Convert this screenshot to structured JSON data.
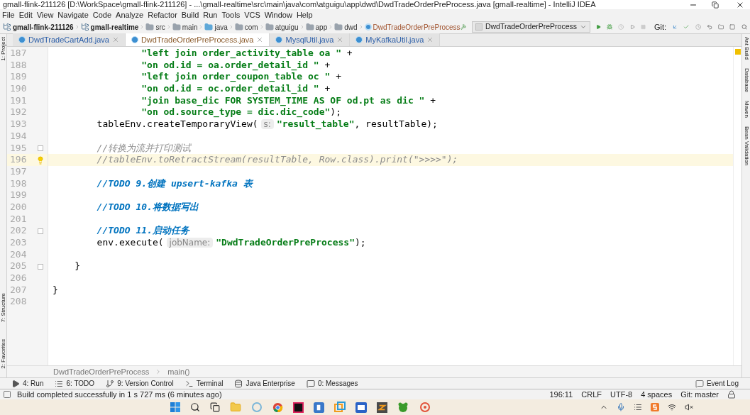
{
  "window": {
    "title": "gmall-flink-211126 [D:\\WorkSpace\\gmall-flink-211126] - ...\\gmall-realtime\\src\\main\\java\\com\\atguigu\\app\\dwd\\DwdTradeOrderPreProcess.java [gmall-realtime] - IntelliJ IDEA"
  },
  "menu": [
    "File",
    "Edit",
    "View",
    "Navigate",
    "Code",
    "Analyze",
    "Refactor",
    "Build",
    "Run",
    "Tools",
    "VCS",
    "Window",
    "Help"
  ],
  "navbar": {
    "crumbs": [
      {
        "kind": "module",
        "label": "gmall-flink-211126"
      },
      {
        "kind": "module",
        "label": "gmall-realtime"
      },
      {
        "kind": "folder",
        "label": "src"
      },
      {
        "kind": "folder",
        "label": "main"
      },
      {
        "kind": "source",
        "label": "java"
      },
      {
        "kind": "folder",
        "label": "com"
      },
      {
        "kind": "folder",
        "label": "atguigu"
      },
      {
        "kind": "folder",
        "label": "app"
      },
      {
        "kind": "folder",
        "label": "dwd"
      },
      {
        "kind": "class",
        "label": "DwdTradeOrderPreProcess"
      }
    ],
    "run_config": "DwdTradeOrderPreProcess",
    "git_label": "Git:"
  },
  "tabs": [
    {
      "label": "DwdTradeCartAdd.java",
      "selected": false
    },
    {
      "label": "DwdTradeOrderPreProcess.java",
      "selected": true
    },
    {
      "label": "MysqlUtil.java",
      "selected": false
    },
    {
      "label": "MyKafkaUtil.java",
      "selected": false
    }
  ],
  "left_tools": {
    "top": [
      "1: Project"
    ],
    "bottom": [
      "7: Structure",
      "2: Favorites"
    ]
  },
  "right_tools": [
    "Ant Build",
    "Database",
    "Maven",
    "Bean Validation"
  ],
  "editor": {
    "lines": [
      {
        "number": "187",
        "current": false,
        "fold": false,
        "bulb": false,
        "tokens": [
          {
            "kind": "string",
            "text": "                \"left join order_activity_table oa \""
          },
          {
            "kind": "code",
            "text": " +"
          }
        ]
      },
      {
        "number": "188",
        "current": false,
        "fold": false,
        "bulb": false,
        "tokens": [
          {
            "kind": "string",
            "text": "                \"on od.id = oa.order_detail_id \""
          },
          {
            "kind": "code",
            "text": " +"
          }
        ]
      },
      {
        "number": "189",
        "current": false,
        "fold": false,
        "bulb": false,
        "tokens": [
          {
            "kind": "string",
            "text": "                \"left join order_coupon_table oc \""
          },
          {
            "kind": "code",
            "text": " +"
          }
        ]
      },
      {
        "number": "190",
        "current": false,
        "fold": false,
        "bulb": false,
        "tokens": [
          {
            "kind": "string",
            "text": "                \"on od.id = oc.order_detail_id \""
          },
          {
            "kind": "code",
            "text": " +"
          }
        ]
      },
      {
        "number": "191",
        "current": false,
        "fold": false,
        "bulb": false,
        "tokens": [
          {
            "kind": "string",
            "text": "                \"join base_dic FOR SYSTEM_TIME AS OF od.pt as dic \""
          },
          {
            "kind": "code",
            "text": " +"
          }
        ]
      },
      {
        "number": "192",
        "current": false,
        "fold": false,
        "bulb": false,
        "tokens": [
          {
            "kind": "string",
            "text": "                \"on od.source_type = dic.dic_code\""
          },
          {
            "kind": "code",
            "text": ");"
          }
        ]
      },
      {
        "number": "193",
        "current": false,
        "fold": false,
        "bulb": false,
        "tokens": [
          {
            "kind": "code",
            "text": "        tableEnv.createTemporaryView("
          },
          {
            "kind": "hint",
            "text": "s:"
          },
          {
            "kind": "string",
            "text": "\"result_table\""
          },
          {
            "kind": "code",
            "text": ", resultTable);"
          }
        ]
      },
      {
        "number": "194",
        "current": false,
        "fold": false,
        "bulb": false
      },
      {
        "number": "195",
        "current": false,
        "fold": true,
        "bulb": false,
        "tokens": [
          {
            "kind": "comment",
            "text": "        //转换为流并打印测试"
          }
        ]
      },
      {
        "number": "196",
        "current": true,
        "fold": false,
        "bulb": true,
        "tokens": [
          {
            "kind": "comment",
            "text": "        //tableEnv.toRetractStream(resultTable, Row.class).print(\">>>>\");"
          }
        ]
      },
      {
        "number": "197",
        "current": false,
        "fold": false,
        "bulb": false
      },
      {
        "number": "198",
        "current": false,
        "fold": false,
        "bulb": false,
        "tokens": [
          {
            "kind": "todo",
            "text": "        //TODO 9.创建 upsert-kafka 表"
          }
        ]
      },
      {
        "number": "199",
        "current": false,
        "fold": false,
        "bulb": false
      },
      {
        "number": "200",
        "current": false,
        "fold": false,
        "bulb": false,
        "tokens": [
          {
            "kind": "todo",
            "text": "        //TODO 10.将数据写出"
          }
        ]
      },
      {
        "number": "201",
        "current": false,
        "fold": false,
        "bulb": false
      },
      {
        "number": "202",
        "current": false,
        "fold": true,
        "bulb": false,
        "tokens": [
          {
            "kind": "todo",
            "text": "        //TODO 11.启动任务"
          }
        ]
      },
      {
        "number": "203",
        "current": false,
        "fold": false,
        "bulb": false,
        "tokens": [
          {
            "kind": "code",
            "text": "        env.execute("
          },
          {
            "kind": "hint",
            "text": "jobName:"
          },
          {
            "kind": "string",
            "text": "\"DwdTradeOrderPreProcess\""
          },
          {
            "kind": "code",
            "text": ");"
          }
        ]
      },
      {
        "number": "204",
        "current": false,
        "fold": false,
        "bulb": false
      },
      {
        "number": "205",
        "current": false,
        "fold": true,
        "bulb": false,
        "tokens": [
          {
            "kind": "code",
            "text": "    }"
          }
        ]
      },
      {
        "number": "206",
        "current": false,
        "fold": false,
        "bulb": false
      },
      {
        "number": "207",
        "current": false,
        "fold": false,
        "bulb": false,
        "tokens": [
          {
            "kind": "code",
            "text": "}"
          }
        ]
      },
      {
        "number": "208",
        "current": false,
        "fold": false,
        "bulb": false
      }
    ]
  },
  "breadcrumb": [
    "DwdTradeOrderPreProcess",
    "main()"
  ],
  "tool_windows": [
    {
      "kind": "run",
      "label": "4: Run"
    },
    {
      "kind": "todo",
      "label": "6: TODO"
    },
    {
      "kind": "vcs",
      "label": "9: Version Control"
    },
    {
      "kind": "terminal",
      "label": "Terminal"
    },
    {
      "kind": "enterprise",
      "label": "Java Enterprise"
    },
    {
      "kind": "messages",
      "label": "0: Messages"
    }
  ],
  "event_log": "Event Log",
  "status_bar": {
    "message": "Build completed successfully in 1 s 727 ms (6 minutes ago)",
    "items": [
      "196:11",
      "CRLF",
      "UTF-8",
      "4 spaces",
      "Git: master"
    ]
  }
}
